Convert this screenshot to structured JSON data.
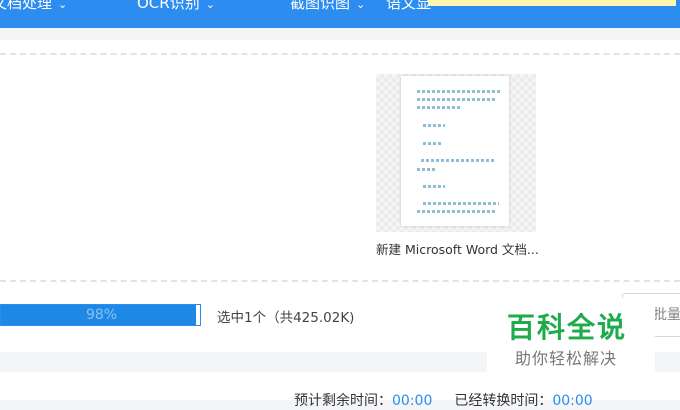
{
  "nav": {
    "items": [
      {
        "label": "文档处理",
        "chev": "⌄"
      },
      {
        "label": "OCR识别",
        "chev": "⌄"
      },
      {
        "label": "截图识图",
        "chev": "⌄"
      },
      {
        "label": "语文显"
      }
    ]
  },
  "file": {
    "name": "新建 Microsoft Word 文档..."
  },
  "progress": {
    "value": 0.98,
    "label": "98%"
  },
  "selection": {
    "text": "选中1个（共425.02K)"
  },
  "batch_button": {
    "label": "批量转"
  },
  "watermark": {
    "title": "百科全说",
    "subtitle": "助你轻松解决"
  },
  "timing": {
    "remaining_label": "预计剩余时间：",
    "remaining_value": "00:00",
    "elapsed_label": "已经转换时间：",
    "elapsed_value": "00:00"
  },
  "colors": {
    "nav_bg": "#2d8cf0",
    "progress_fill": "#1e88e5",
    "watermark_green": "#1eab4c"
  }
}
